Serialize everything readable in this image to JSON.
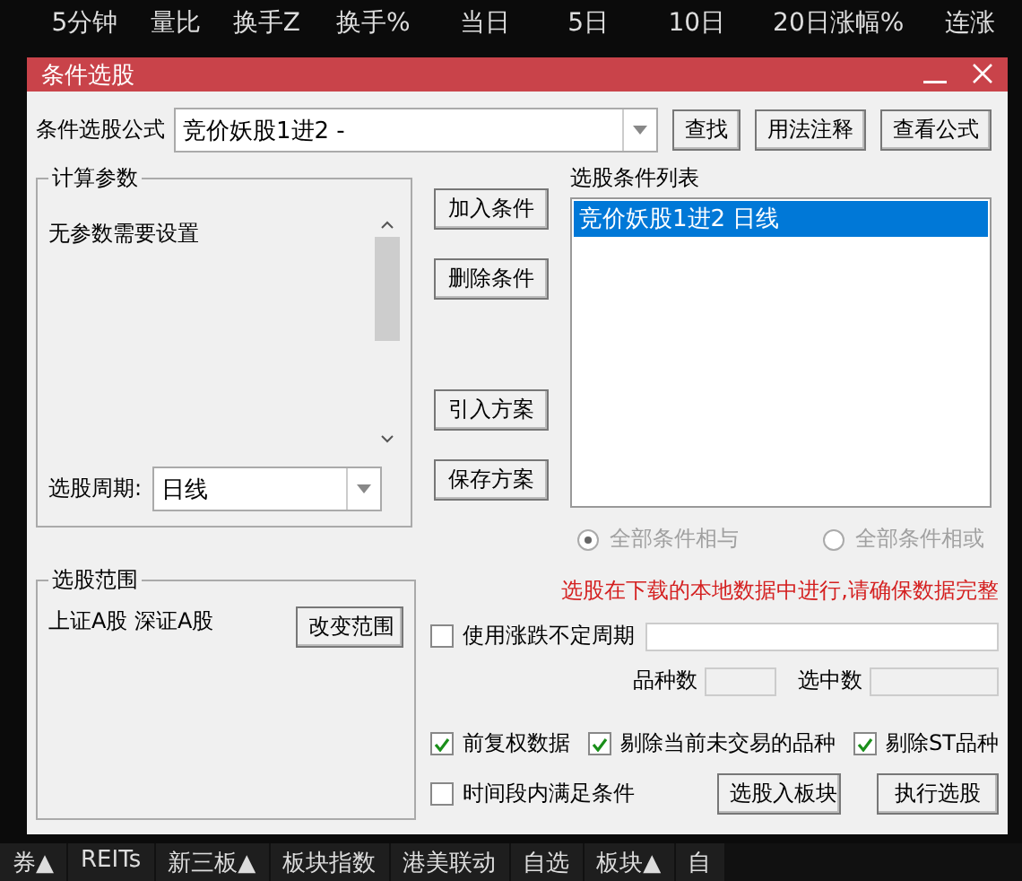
{
  "table": {
    "columns": [
      "5分钟",
      "量比",
      "换手Z",
      "换手%",
      "当日",
      "5日",
      "10日",
      "20日涨幅%",
      "连涨"
    ]
  },
  "dialog": {
    "title": "条件选股",
    "formula": {
      "label": "条件选股公式",
      "value": "竞价妖股1进2 -",
      "buttons": [
        "查找",
        "用法注释",
        "查看公式"
      ]
    },
    "params": {
      "title": "计算参数",
      "message": "无参数需要设置",
      "period_label": "选股周期:",
      "period_value": "日线"
    },
    "actions": [
      "加入条件",
      "删除条件",
      "引入方案",
      "保存方案"
    ],
    "conditions": {
      "title": "选股条件列表",
      "items": [
        {
          "label": "竞价妖股1进2  日线",
          "selected": true
        }
      ]
    },
    "logic": [
      {
        "label": "全部条件相与",
        "selected": true,
        "disabled": true
      },
      {
        "label": "全部条件相或",
        "selected": false,
        "disabled": true
      }
    ],
    "scope": {
      "title": "选股范围",
      "value": "上证A股 深证A股",
      "button": "改变范围"
    },
    "notice": "选股在下载的本地数据中进行,请确保数据完整",
    "variable_period": {
      "label": "使用涨跌不定周期",
      "checked": false
    },
    "counts": [
      {
        "label": "品种数"
      },
      {
        "label": "选中数"
      }
    ],
    "options": [
      {
        "label": "前复权数据",
        "checked": true
      },
      {
        "label": "剔除当前未交易的品种",
        "checked": true
      },
      {
        "label": "剔除ST品种",
        "checked": true
      }
    ],
    "time_range": {
      "label": "时间段内满足条件",
      "checked": false
    },
    "buttons": [
      "选股入板块",
      "执行选股"
    ]
  },
  "bottom_tabs": [
    "券▲",
    "REITs",
    "新三板▲",
    "板块指数",
    "港美联动",
    "自选",
    "板块▲",
    "自"
  ]
}
